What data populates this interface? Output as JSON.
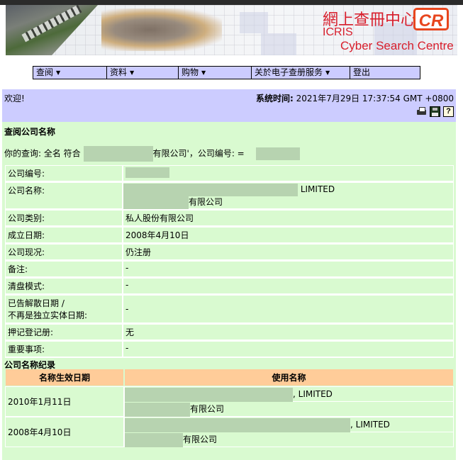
{
  "banner": {
    "title_cn": "網上查冊中心",
    "logo_mark": "CR",
    "title_en_1": "ICRIS",
    "title_en_2": "Cyber Search Centre"
  },
  "nav": {
    "items": [
      {
        "label": "查阅",
        "has_dropdown": true,
        "caret": "▼"
      },
      {
        "label": "资料",
        "has_dropdown": true,
        "caret": "▼"
      },
      {
        "label": "购物",
        "has_dropdown": true,
        "caret": "▼"
      },
      {
        "label": "关於电子查册服务",
        "has_dropdown": true,
        "caret": "▼"
      },
      {
        "label": "登出",
        "has_dropdown": false
      }
    ]
  },
  "welcome": {
    "greeting": "欢迎!",
    "system_time_label": "系统时间:",
    "system_time_value": "2021年7月29日 17:37:54 GMT +0800",
    "icons": [
      "print-icon",
      "save-icon",
      "help-icon"
    ],
    "help_glyph": "?"
  },
  "search": {
    "title": "查阅公司名称",
    "query_prefix": "你的查询:  全名 符合",
    "query_suffix": "有限公司'，公司编号:  =",
    "redacted": true
  },
  "company_info": {
    "rows": [
      {
        "label": "公司编号:",
        "value": "",
        "redacted": true
      },
      {
        "label": "公司名称:",
        "value_line1": "LIMITED",
        "value_line2": "有限公司",
        "redacted": true
      },
      {
        "label": "公司类别:",
        "value": "私人股份有限公司"
      },
      {
        "label": "成立日期:",
        "value": "2008年4月10日"
      },
      {
        "label": "公司现况:",
        "value": "仍注册"
      },
      {
        "label": "备注:",
        "value": "-"
      },
      {
        "label": "清盘模式:",
        "value": "-"
      },
      {
        "label_line1": "已告解散日期 /",
        "label_line2": "不再是独立实体日期:",
        "value": "-"
      },
      {
        "label": "押记登记册:",
        "value": "无"
      },
      {
        "label": "重要事项:",
        "value": "-"
      }
    ]
  },
  "name_history": {
    "title": "公司名称纪录",
    "headers": [
      "名称生效日期",
      "使用名称"
    ],
    "rows": [
      {
        "date": "2010年1月11日",
        "name_en": ", LIMITED",
        "name_cn": "有限公司"
      },
      {
        "date": "2008年4月10日",
        "name_en": ", LIMITED",
        "name_cn": "有限公司"
      }
    ]
  },
  "colors": {
    "nav_bg": "#ccccff",
    "content_bg": "#d9fad0",
    "table_header_bg": "#ffcc99",
    "logo_red": "#d81e2c"
  }
}
